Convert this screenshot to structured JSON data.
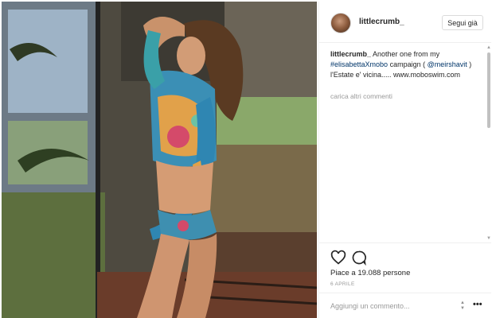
{
  "post": {
    "username": "littlecrumb_",
    "follow_label": "Segui già",
    "caption": {
      "user": "littlecrumb_",
      "text_1": "Another one from my",
      "hashtag": "#elisabettaXmobo",
      "text_2": "campaign (",
      "mention": "@meirshavit",
      "text_3": ") l'Estate e' vicina..... www.moboswim.com"
    },
    "load_more": "carica altri commenti",
    "likes": "Piace a 19.088 persone",
    "date": "6 APRILE",
    "comment_placeholder": "Aggiungi un commento..."
  },
  "icons": {
    "like": "heart-icon",
    "comment": "speech-bubble-icon",
    "more": "ellipsis-icon"
  },
  "colors": {
    "link": "#003569",
    "muted": "#999999",
    "border": "#efefef"
  }
}
